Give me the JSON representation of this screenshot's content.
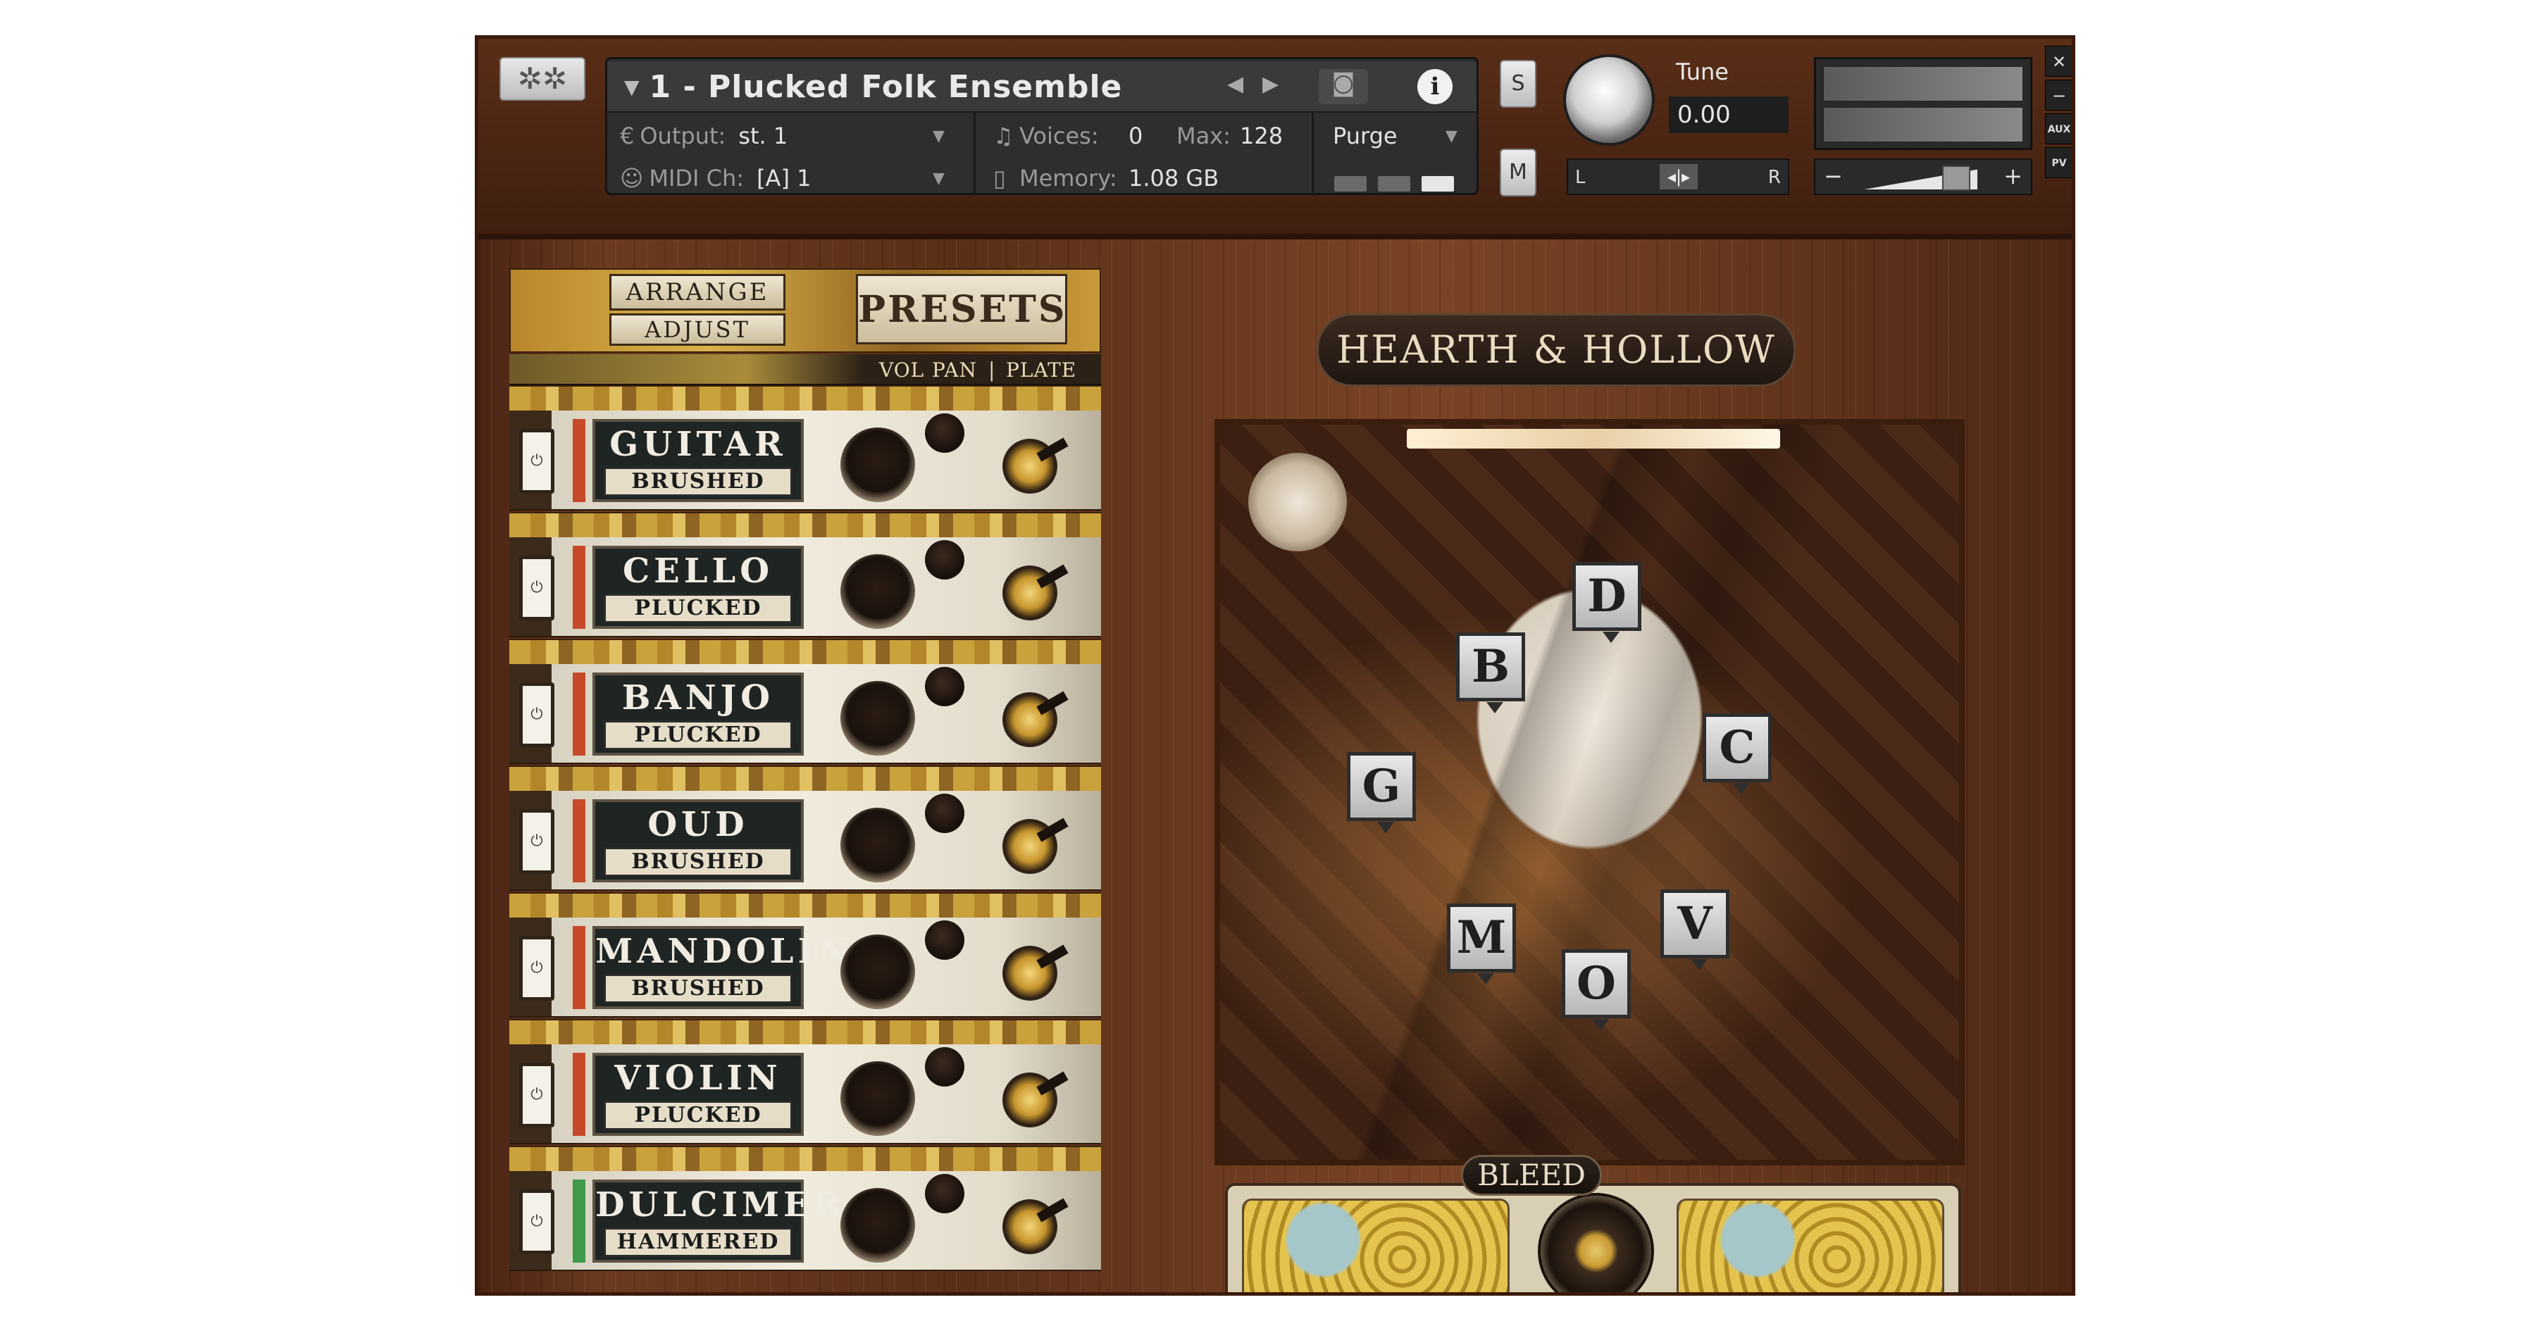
{
  "header": {
    "instrument_name": "1 - Plucked Folk Ensemble",
    "output_label": "Output:",
    "output_value": "st. 1",
    "voices_label": "Voices:",
    "voices_value": "0",
    "max_label": "Max:",
    "max_value": "128",
    "purge_label": "Purge",
    "midi_label": "MIDI Ch:",
    "midi_value": "[A]  1",
    "memory_label": "Memory:",
    "memory_value": "1.08 GB",
    "solo_label": "S",
    "mute_label": "M",
    "tune_label": "Tune",
    "tune_value": "0.00",
    "pan_left": "L",
    "pan_right": "R",
    "vol_minus": "−",
    "vol_plus": "+",
    "aux_label": "AUX",
    "pv_label": "PV"
  },
  "tabs": {
    "arrange": "ARRANGE",
    "adjust": "ADJUST",
    "presets": "PRESETS"
  },
  "columns": {
    "vol": "VOL",
    "pan": "PAN",
    "divider": "|",
    "plate": "PLATE"
  },
  "instruments": [
    {
      "name": "GUITAR",
      "articulation": "BRUSHED",
      "accent": "#c64a2a"
    },
    {
      "name": "CELLO",
      "articulation": "PLUCKED",
      "accent": "#c64a2a"
    },
    {
      "name": "BANJO",
      "articulation": "PLUCKED",
      "accent": "#c64a2a"
    },
    {
      "name": "OUD",
      "articulation": "BRUSHED",
      "accent": "#c64a2a"
    },
    {
      "name": "MANDOLIN",
      "articulation": "BRUSHED",
      "accent": "#c64a2a"
    },
    {
      "name": "VIOLIN",
      "articulation": "PLUCKED",
      "accent": "#c64a2a"
    },
    {
      "name": "DULCIMER",
      "articulation": "HAMMERED",
      "accent": "#3f9a4a"
    }
  ],
  "room": {
    "title": "HEARTH & HOLLOW",
    "markers": [
      "D",
      "B",
      "C",
      "G",
      "V",
      "M",
      "O"
    ]
  },
  "bleed": {
    "label": "BLEED"
  },
  "icons": {
    "gear": "gear-icon",
    "camera": "camera-icon",
    "info": "info-icon",
    "power": "power-icon",
    "close": "close-icon",
    "minimize": "minimize-icon"
  }
}
